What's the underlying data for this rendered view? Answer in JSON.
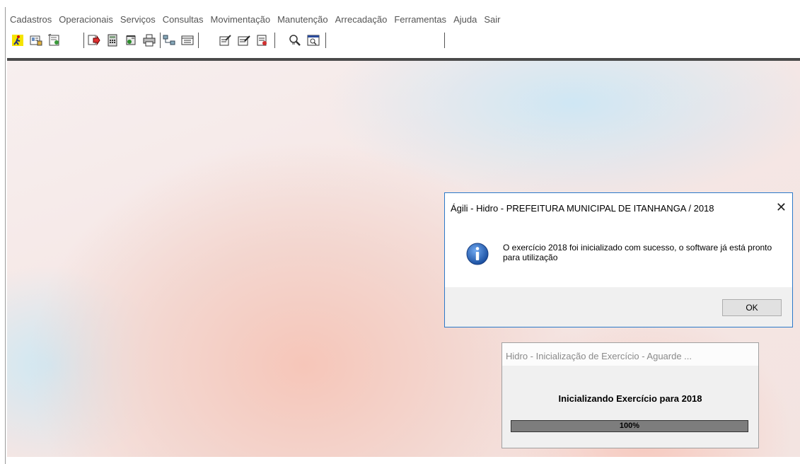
{
  "menu": {
    "items": [
      "Cadastros",
      "Operacionais",
      "Serviços",
      "Consultas",
      "Movimentação",
      "Manutenção",
      "Arrecadação",
      "Ferramentas",
      "Ajuda",
      "Sair"
    ]
  },
  "toolbar": {
    "icons": [
      "runner-exit-icon",
      "id-card-icon",
      "certificate-icon",
      "blank-icon",
      "document-arrow-icon",
      "calculator-icon",
      "receipt-check-icon",
      "printer-icon",
      "network-icon",
      "form-icon",
      "form-edit-icon",
      "notepad-edit-icon",
      "report-icon",
      "magnify-search-icon",
      "preview-window-icon"
    ]
  },
  "message_dialog": {
    "title": "Ágili - Hidro - PREFEITURA MUNICIPAL DE ITANHANGA / 2018",
    "close_label": "✕",
    "message": "O exercício 2018 foi inicializado com sucesso, o software já está pronto para utilização",
    "ok_label": "OK"
  },
  "progress_dialog": {
    "title": "Hidro - Inicialização de Exercício - Aguarde ...",
    "label": "Inicializando Exercício para 2018",
    "progress_text": "100%",
    "progress_value": 1.0
  },
  "colors": {
    "dialog_border": "#2b79c9",
    "progress_fill": "#7d7d7d",
    "info_icon": "#1e5fb4"
  }
}
